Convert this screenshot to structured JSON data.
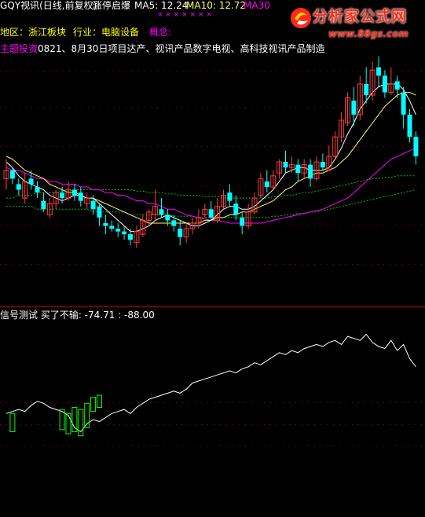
{
  "header": {
    "stock_title": "GQY视讯(日线,前复权)",
    "pattern_label": "涨停启爆",
    "ma5_label": "MA5: 12.24",
    "ma10_label": "MA10: 12.72",
    "ma30_label": "MA30"
  },
  "info": {
    "region_label": "地区：浙江板块",
    "industry_label": "行业：电脑设备",
    "concept_label": "概念:",
    "theme_prefix": "主题投资",
    "theme_text": "0821、8月30日项目达产、视讯产品数字电视、高科技视讯产品制造"
  },
  "indicator": {
    "title": "信号测试 买了不输: -74.71 : -88.00"
  },
  "logo": {
    "name": "分析家公式网",
    "url": "www.88gs.com"
  },
  "colors": {
    "up": "#ff3c3c",
    "down": "#00ffff",
    "ma5": "#ffffff",
    "ma10": "#ffff66",
    "ma30": "#ff00ff",
    "ma_green": "#00c000",
    "indicator_line": "#ffffff",
    "signal_bar": "#00ff00"
  },
  "chart_data": {
    "type": "line",
    "candles": [
      [
        12.3,
        12.6,
        13.0,
        11.9
      ],
      [
        12.6,
        12.3,
        12.7,
        12.1
      ],
      [
        12.1,
        11.9,
        12.3,
        11.7
      ],
      [
        11.6,
        12.2,
        12.5,
        11.4
      ],
      [
        12.3,
        12.1,
        12.6,
        11.9
      ],
      [
        12.0,
        11.8,
        12.2,
        11.6
      ],
      [
        11.5,
        11.2,
        11.8,
        11.1
      ],
      [
        11.0,
        11.4,
        11.6,
        10.9
      ],
      [
        11.4,
        11.8,
        11.9,
        11.2
      ],
      [
        11.8,
        11.6,
        12.0,
        11.4
      ],
      [
        11.6,
        11.9,
        12.2,
        11.5
      ],
      [
        11.9,
        11.7,
        12.1,
        11.5
      ],
      [
        11.8,
        11.5,
        12.0,
        11.3
      ],
      [
        11.4,
        11.6,
        11.8,
        11.2
      ],
      [
        11.5,
        11.2,
        11.7,
        11.0
      ],
      [
        11.3,
        10.9,
        11.4,
        10.6
      ],
      [
        10.7,
        10.6,
        11.0,
        10.3
      ],
      [
        10.6,
        10.5,
        10.8,
        10.4
      ],
      [
        10.5,
        10.4,
        10.7,
        10.2
      ],
      [
        10.4,
        10.3,
        10.6,
        10.1
      ],
      [
        10.3,
        10.1,
        10.5,
        9.9
      ],
      [
        10.0,
        10.4,
        10.6,
        9.8
      ],
      [
        10.3,
        10.8,
        11.0,
        10.2
      ],
      [
        10.8,
        11.1,
        11.2,
        10.6
      ],
      [
        11.0,
        11.3,
        11.9,
        10.8
      ],
      [
        11.2,
        11.0,
        11.6,
        10.9
      ],
      [
        11.0,
        10.8,
        11.2,
        10.6
      ],
      [
        10.8,
        10.6,
        11.0,
        10.4
      ],
      [
        10.5,
        10.2,
        10.8,
        9.9
      ],
      [
        10.2,
        10.5,
        10.7,
        10.0
      ],
      [
        10.5,
        10.7,
        10.9,
        10.3
      ],
      [
        10.7,
        10.9,
        11.2,
        10.5
      ],
      [
        11.0,
        11.2,
        11.4,
        10.9
      ],
      [
        11.2,
        10.9,
        11.5,
        10.8
      ],
      [
        10.8,
        11.3,
        11.6,
        10.7
      ],
      [
        11.3,
        11.7,
        11.9,
        11.2
      ],
      [
        11.8,
        11.5,
        12.1,
        11.3
      ],
      [
        11.4,
        11.0,
        11.7,
        10.8
      ],
      [
        10.9,
        10.6,
        11.1,
        10.3
      ],
      [
        10.6,
        11.1,
        11.4,
        10.5
      ],
      [
        11.1,
        11.6,
        11.8,
        11.0
      ],
      [
        11.7,
        12.3,
        12.5,
        11.6
      ],
      [
        12.2,
        12.0,
        12.6,
        11.8
      ],
      [
        12.0,
        12.4,
        12.6,
        11.9
      ],
      [
        12.5,
        12.9,
        13.0,
        12.3
      ],
      [
        12.9,
        12.7,
        13.3,
        12.5
      ],
      [
        12.7,
        12.8,
        13.1,
        12.5
      ],
      [
        12.8,
        12.5,
        13.0,
        12.2
      ],
      [
        12.5,
        12.8,
        13.0,
        12.3
      ],
      [
        12.8,
        12.3,
        13.0,
        12.0
      ],
      [
        12.3,
        12.9,
        13.1,
        12.2
      ],
      [
        12.9,
        12.7,
        13.2,
        12.6
      ],
      [
        12.6,
        13.1,
        13.5,
        12.6
      ],
      [
        13.1,
        13.8,
        14.0,
        13.0
      ],
      [
        13.8,
        14.4,
        14.7,
        13.6
      ],
      [
        14.3,
        15.2,
        15.4,
        14.2
      ],
      [
        15.1,
        14.6,
        15.6,
        14.2
      ],
      [
        14.6,
        15.7,
        16.0,
        14.4
      ],
      [
        15.7,
        15.3,
        16.3,
        15.0
      ],
      [
        15.3,
        16.2,
        16.5,
        15.1
      ],
      [
        16.3,
        16.0,
        16.7,
        15.6
      ],
      [
        16.0,
        15.4,
        16.2,
        15.2
      ],
      [
        15.4,
        15.7,
        16.3,
        15.3
      ],
      [
        15.8,
        15.5,
        16.0,
        15.2
      ],
      [
        15.4,
        14.6,
        15.6,
        14.1
      ],
      [
        14.6,
        13.8,
        14.8,
        13.6
      ],
      [
        13.8,
        13.1,
        14.0,
        12.8
      ]
    ],
    "ma5": [
      12.9,
      12.7,
      12.4,
      12.2,
      12.1,
      12.0,
      11.9,
      11.7,
      11.6,
      11.5,
      11.6,
      11.7,
      11.7,
      11.6,
      11.6,
      11.4,
      11.2,
      11.0,
      10.8,
      10.6,
      10.4,
      10.4,
      10.5,
      10.6,
      10.8,
      10.9,
      11.0,
      10.9,
      10.8,
      10.7,
      10.6,
      10.6,
      10.7,
      10.8,
      11.0,
      11.2,
      11.3,
      11.3,
      11.2,
      11.2,
      11.3,
      11.5,
      11.7,
      11.9,
      12.2,
      12.5,
      12.6,
      12.7,
      12.7,
      12.6,
      12.6,
      12.6,
      12.7,
      13.0,
      13.4,
      13.9,
      14.3,
      14.8,
      15.1,
      15.4,
      15.6,
      15.7,
      15.7,
      15.7,
      15.5,
      15.1,
      14.6
    ],
    "ma10": [
      13.1,
      13.0,
      12.8,
      12.6,
      12.5,
      12.4,
      12.3,
      12.1,
      12.0,
      11.9,
      11.8,
      11.8,
      11.7,
      11.6,
      11.6,
      11.5,
      11.4,
      11.3,
      11.2,
      11.1,
      11.0,
      10.9,
      10.8,
      10.7,
      10.7,
      10.7,
      10.7,
      10.7,
      10.7,
      10.7,
      10.7,
      10.7,
      10.8,
      10.8,
      10.9,
      10.9,
      11.0,
      11.0,
      11.1,
      11.1,
      11.2,
      11.3,
      11.4,
      11.5,
      11.7,
      11.9,
      12.0,
      12.2,
      12.3,
      12.4,
      12.5,
      12.5,
      12.6,
      12.7,
      12.9,
      13.1,
      13.4,
      13.7,
      14.0,
      14.3,
      14.6,
      14.9,
      15.1,
      15.3,
      15.4,
      15.4,
      15.3
    ],
    "ma30": [
      12.7,
      12.6,
      12.6,
      12.5,
      12.4,
      12.3,
      12.3,
      12.2,
      12.2,
      12.1,
      12.1,
      12.1,
      12.0,
      12.0,
      11.9,
      11.9,
      11.8,
      11.8,
      11.7,
      11.7,
      11.6,
      11.5,
      11.5,
      11.4,
      11.4,
      11.3,
      11.2,
      11.2,
      11.1,
      11.0,
      10.95,
      10.9,
      10.85,
      10.8,
      10.8,
      10.75,
      10.7,
      10.7,
      10.7,
      10.7,
      10.7,
      10.7,
      10.75,
      10.8,
      10.85,
      10.9,
      10.95,
      11.0,
      11.05,
      11.1,
      11.15,
      11.2,
      11.3,
      11.4,
      11.5,
      11.6,
      11.8,
      12.0,
      12.2,
      12.4,
      12.6,
      12.8,
      13.0,
      13.1,
      13.2,
      13.3,
      13.4
    ],
    "ma_green": [
      11.6,
      11.6,
      11.7,
      11.7,
      11.7,
      11.8,
      11.8,
      11.8,
      11.8,
      11.85,
      11.85,
      11.9,
      11.9,
      11.9,
      11.9,
      11.9,
      11.9,
      11.9,
      11.9,
      11.9,
      11.9,
      11.85,
      11.85,
      11.8,
      11.8,
      11.8,
      11.75,
      11.75,
      11.7,
      11.7,
      11.7,
      11.7,
      11.65,
      11.65,
      11.65,
      11.6,
      11.6,
      11.6,
      11.6,
      11.6,
      11.6,
      11.6,
      11.6,
      11.65,
      11.65,
      11.7,
      11.7,
      11.75,
      11.8,
      11.8,
      11.85,
      11.9,
      11.95,
      12.0,
      12.05,
      12.1,
      12.15,
      12.2,
      12.25,
      12.3,
      12.3,
      12.35,
      12.35,
      12.4,
      12.4,
      12.4,
      12.4
    ],
    "ma_green2": [
      11.3,
      11.3,
      11.3,
      11.3,
      11.3,
      11.2,
      11.2,
      11.2,
      11.2,
      11.2,
      11.2,
      11.2,
      11.2,
      11.2,
      11.1,
      11.1,
      11.1,
      11.1,
      11.1,
      11.1,
      11.0,
      11.0,
      11.0,
      11.0,
      11.0,
      11.0,
      11.0,
      10.95,
      10.95,
      10.95,
      10.95,
      10.9,
      10.9,
      10.9,
      10.9,
      10.9,
      10.9,
      10.9,
      10.9,
      10.9,
      10.9,
      10.9,
      10.9,
      10.95,
      10.95,
      11.0,
      11.0,
      11.05,
      11.05,
      11.1,
      11.1,
      11.15,
      11.2,
      11.25,
      11.3,
      11.35,
      11.4,
      11.45,
      11.5,
      11.55,
      11.6,
      11.65,
      11.7,
      11.75,
      11.8,
      11.85,
      11.9
    ],
    "price_range": [
      9.4,
      16.8
    ],
    "indicator_line": [
      -90,
      -88,
      -86,
      -88,
      -82,
      -78,
      -80,
      -84,
      -86,
      -88,
      -92,
      -104,
      -108,
      -100,
      -96,
      -98,
      -94,
      -90,
      -88,
      -86,
      -90,
      -84,
      -80,
      -76,
      -74,
      -72,
      -70,
      -68,
      -70,
      -66,
      -60,
      -58,
      -56,
      -54,
      -52,
      -50,
      -48,
      -50,
      -46,
      -44,
      -40,
      -42,
      -38,
      -34,
      -30,
      -32,
      -28,
      -30,
      -26,
      -24,
      -22,
      -24,
      -20,
      -18,
      -22,
      -14,
      -16,
      -18,
      -12,
      -20,
      -24,
      -26,
      -18,
      -28,
      -22,
      -36,
      -44
    ],
    "signal_bars": [
      [
        1,
        -90,
        -108
      ],
      [
        9,
        -86,
        -106
      ],
      [
        10,
        -90,
        -110
      ],
      [
        11,
        -84,
        -108
      ],
      [
        12,
        -86,
        -112
      ],
      [
        13,
        -80,
        -104
      ],
      [
        14,
        -74,
        -88
      ],
      [
        15,
        -72,
        -84
      ]
    ],
    "indicator_range": [
      -120,
      0
    ]
  }
}
